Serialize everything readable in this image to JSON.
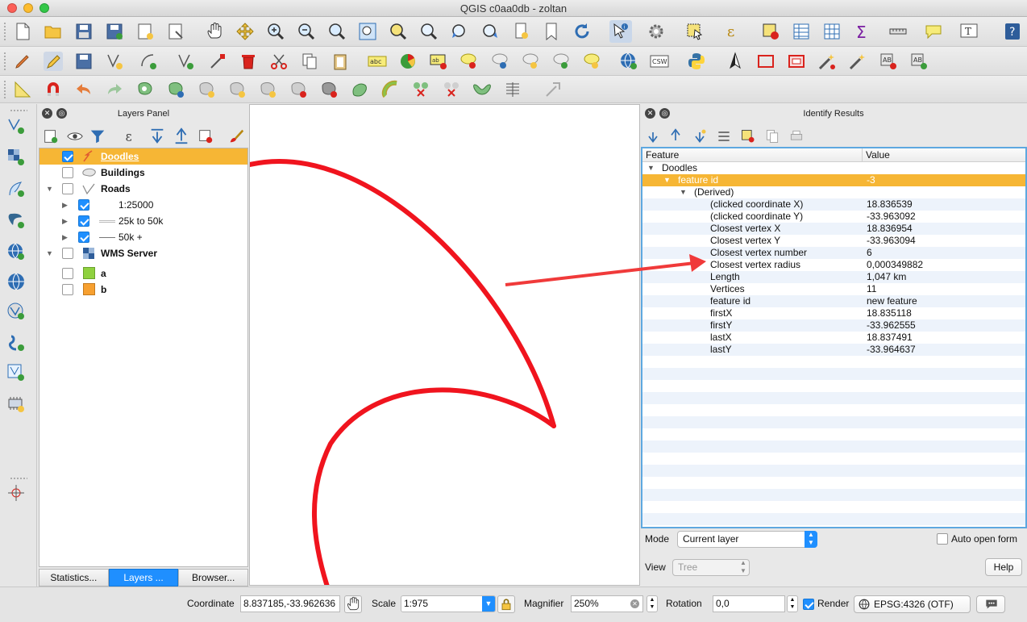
{
  "window": {
    "title": "QGIS c0aa0db - zoltan"
  },
  "layers_panel": {
    "title": "Layers Panel",
    "tree": [
      {
        "label": "Doodles",
        "checked": true,
        "bold": true,
        "selected": true
      },
      {
        "label": "Buildings",
        "checked": false,
        "bold": true
      },
      {
        "label": "Roads",
        "checked": false,
        "bold": true
      },
      {
        "label": "1:25000",
        "checked": true
      },
      {
        "label": "25k to 50k",
        "checked": true
      },
      {
        "label": "50k +",
        "checked": true
      },
      {
        "label": "WMS Server",
        "checked": false,
        "bold": true
      },
      {
        "label": "a",
        "checked": false,
        "bold": true,
        "swatch": "#8fd13f"
      },
      {
        "label": "b",
        "checked": false,
        "bold": true,
        "swatch": "#f7a030"
      }
    ],
    "tabs": [
      "Statistics...",
      "Layers ...",
      "Browser..."
    ]
  },
  "identify": {
    "title": "Identify Results",
    "columns": {
      "feature": "Feature",
      "value": "Value"
    },
    "rows": [
      {
        "key": "Doodles",
        "value": ""
      },
      {
        "key": "feature id",
        "value": "-3"
      },
      {
        "key": "(Derived)",
        "value": ""
      },
      {
        "key": "(clicked coordinate X)",
        "value": "18.836539"
      },
      {
        "key": "(clicked coordinate Y)",
        "value": "-33.963092"
      },
      {
        "key": "Closest vertex X",
        "value": "18.836954"
      },
      {
        "key": "Closest vertex Y",
        "value": "-33.963094"
      },
      {
        "key": "Closest vertex number",
        "value": "6"
      },
      {
        "key": "Closest vertex radius",
        "value": "0,000349882"
      },
      {
        "key": "Length",
        "value": "1,047 km"
      },
      {
        "key": "Vertices",
        "value": "11"
      },
      {
        "key": "feature id",
        "value": "new feature"
      },
      {
        "key": "firstX",
        "value": "18.835118"
      },
      {
        "key": "firstY",
        "value": "-33.962555"
      },
      {
        "key": "lastX",
        "value": "18.837491"
      },
      {
        "key": "lastY",
        "value": "-33.964637"
      }
    ],
    "mode_label": "Mode",
    "mode_value": "Current layer",
    "auto_open_label": "Auto open form",
    "view_label": "View",
    "view_value": "Tree",
    "help_label": "Help"
  },
  "status": {
    "coordinate_label": "Coordinate",
    "coordinate_value": "8.837185,-33.962636",
    "scale_label": "Scale",
    "scale_value": "1:975",
    "magnifier_label": "Magnifier",
    "magnifier_value": "250%",
    "rotation_label": "Rotation",
    "rotation_value": "0,0",
    "render_label": "Render",
    "crs_label": "EPSG:4326 (OTF)"
  },
  "colors": {
    "accent": "#1f8fff",
    "selection": "#f6b635",
    "doodle": "#f0141e"
  }
}
